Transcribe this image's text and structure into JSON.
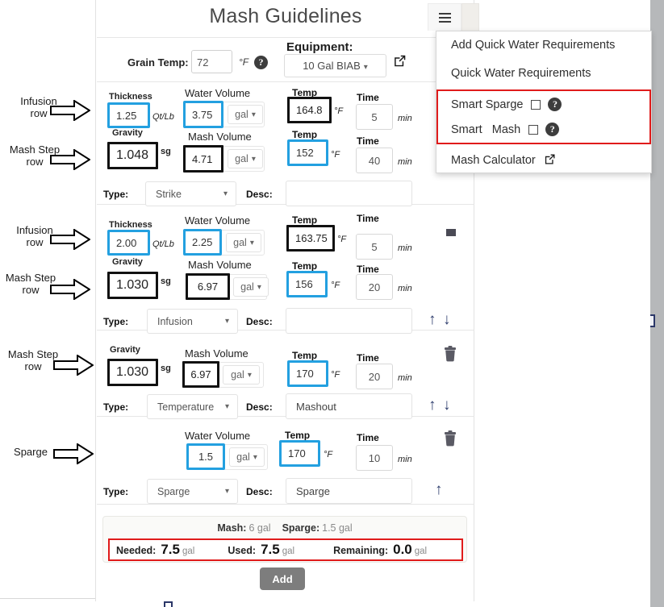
{
  "page": {
    "title": "Mash Guidelines"
  },
  "menu": {
    "button_icon": "hamburger-icon",
    "items": [
      {
        "label": "Add Quick Water Requirements"
      },
      {
        "label": "Quick Water Requirements"
      },
      {
        "label": "Smart Sparge",
        "checkbox": true,
        "help": "?"
      },
      {
        "label": "Smart   Mash",
        "checkbox": true,
        "help": "?"
      },
      {
        "label": "Mash Calculator",
        "external": true
      }
    ],
    "highlight_color": "#e01b1b"
  },
  "header": {
    "grain_temp_label": "Grain Temp:",
    "grain_temp_value": "72",
    "grain_temp_unit": "°F",
    "help": "?",
    "equipment_label": "Equipment:",
    "equipment_value": "10 Gal BIAB"
  },
  "labels": {
    "thickness": "Thickness",
    "gravity": "Gravity",
    "water_volume": "Water Volume",
    "mash_volume": "Mash Volume",
    "temp": "Temp",
    "time": "Time",
    "type": "Type:",
    "desc": "Desc:",
    "qtlb": "Qt/Lb",
    "sg": "sg",
    "degF": "°F",
    "min": "min",
    "gal": "gal"
  },
  "steps": [
    {
      "thickness": "1.25",
      "gravity": "1.048",
      "water_volume": "3.75",
      "water_unit": "gal",
      "mash_volume": "4.71",
      "mash_unit": "gal",
      "temp_top": "164.8",
      "time_top": "5",
      "temp_bottom": "152",
      "time_bottom": "40",
      "type": "Strike",
      "desc": ""
    },
    {
      "thickness": "2.00",
      "gravity": "1.030",
      "water_volume": "2.25",
      "water_unit": "gal",
      "mash_volume": "6.97",
      "mash_unit": "gal",
      "temp_top": "163.75",
      "time_top": "5",
      "temp_bottom": "156",
      "time_bottom": "20",
      "type": "Infusion",
      "desc": ""
    },
    {
      "gravity": "1.030",
      "mash_volume": "6.97",
      "mash_unit": "gal",
      "temp_bottom": "170",
      "time_bottom": "20",
      "type": "Temperature",
      "desc": "Mashout"
    },
    {
      "water_volume": "1.5",
      "water_unit": "gal",
      "temp_bottom": "170",
      "time_bottom": "10",
      "type": "Sparge",
      "desc": "Sparge"
    }
  ],
  "summary": {
    "mash_label": "Mash:",
    "mash_value": "6 gal",
    "sparge_label": "Sparge:",
    "sparge_value": "1.5 gal",
    "needed_label": "Needed:",
    "needed_value": "7.5",
    "needed_unit": "gal",
    "used_label": "Used:",
    "used_value": "7.5",
    "used_unit": "gal",
    "remaining_label": "Remaining:",
    "remaining_value": "0.0",
    "remaining_unit": "gal",
    "add_button": "Add"
  },
  "annotations": [
    {
      "line1": "Infusion",
      "line2": "row"
    },
    {
      "line1": "Mash Step",
      "line2": "row"
    },
    {
      "line1": "Infusion",
      "line2": "row"
    },
    {
      "line1": "Mash Step",
      "line2": "row"
    },
    {
      "line1": "Mash Step",
      "line2": "row"
    },
    {
      "line1": "Sparge",
      "line2": ""
    }
  ]
}
